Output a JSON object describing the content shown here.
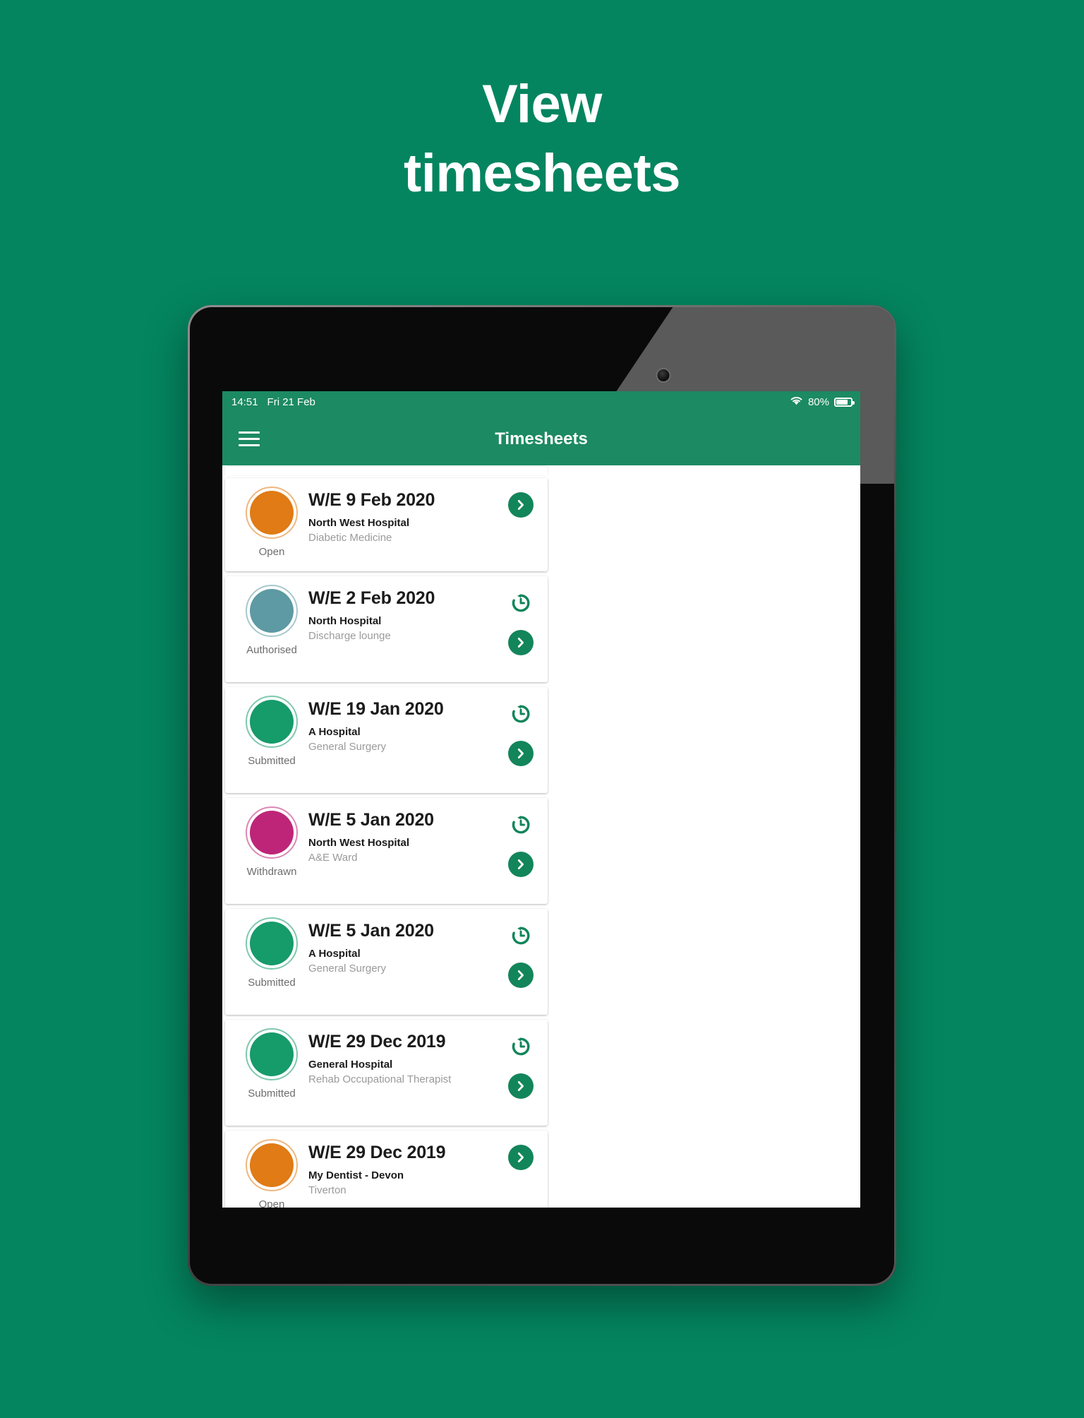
{
  "promo": {
    "line1": "View",
    "line2": "timesheets"
  },
  "status_bar": {
    "time": "14:51",
    "date": "Fri 21 Feb",
    "wifi_icon": "wifi-icon",
    "battery_percent": "80%",
    "battery_icon": "battery-icon",
    "battery_level": 80
  },
  "app_bar": {
    "menu_icon": "hamburger-menu-icon",
    "title": "Timesheets"
  },
  "colors": {
    "brand_green": "#04855F",
    "app_bar_green": "#1C8A63",
    "status_open": "#E07B15",
    "status_authorised": "#5E9AA3",
    "status_submitted": "#169B6B",
    "status_withdrawn": "#BE2579",
    "action_green": "#13855B"
  },
  "timesheets": [
    {
      "week_ending": "W/E 9 Feb 2020",
      "organisation": "North West Hospital",
      "department": "Diabetic Medicine",
      "status": "Open",
      "status_color": "#E07B15",
      "has_history": false,
      "has_chevron": true
    },
    {
      "week_ending": "W/E 2 Feb 2020",
      "organisation": "North Hospital",
      "department": "Discharge lounge",
      "status": "Authorised",
      "status_color": "#5E9AA3",
      "has_history": true,
      "has_chevron": true
    },
    {
      "week_ending": "W/E 19 Jan 2020",
      "organisation": "A Hospital",
      "department": "General Surgery",
      "status": "Submitted",
      "status_color": "#169B6B",
      "has_history": true,
      "has_chevron": true
    },
    {
      "week_ending": "W/E 5 Jan 2020",
      "organisation": "North West Hospital",
      "department": "A&E Ward",
      "status": "Withdrawn",
      "status_color": "#BE2579",
      "has_history": true,
      "has_chevron": true
    },
    {
      "week_ending": "W/E 5 Jan 2020",
      "organisation": "A Hospital",
      "department": "General Surgery",
      "status": "Submitted",
      "status_color": "#169B6B",
      "has_history": true,
      "has_chevron": true
    },
    {
      "week_ending": "W/E 29 Dec 2019",
      "organisation": "General Hospital",
      "department": "Rehab Occupational Therapist",
      "status": "Submitted",
      "status_color": "#169B6B",
      "has_history": true,
      "has_chevron": true
    },
    {
      "week_ending": "W/E 29 Dec 2019",
      "organisation": "My Dentist - Devon",
      "department": "Tiverton",
      "status": "Open",
      "status_color": "#E07B15",
      "has_history": false,
      "has_chevron": true
    }
  ]
}
